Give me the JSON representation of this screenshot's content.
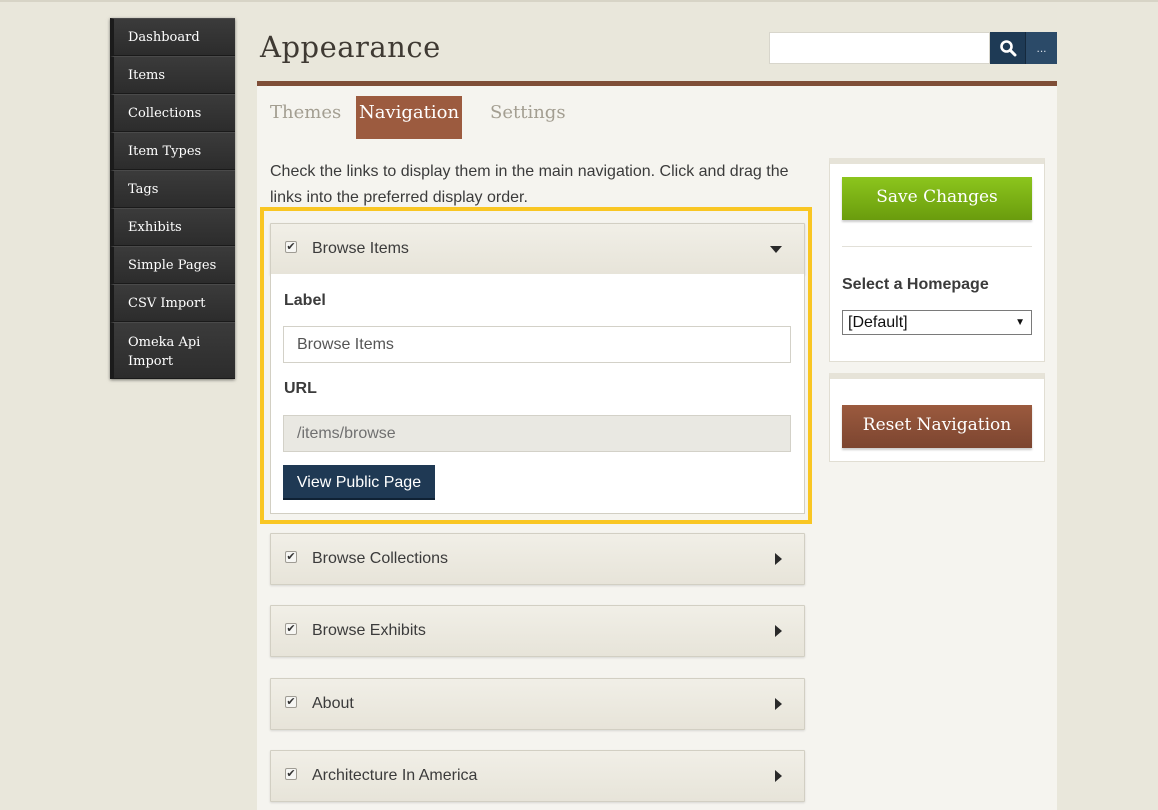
{
  "sidebar": {
    "items": [
      {
        "label": "Dashboard"
      },
      {
        "label": "Items"
      },
      {
        "label": "Collections"
      },
      {
        "label": "Item Types"
      },
      {
        "label": "Tags"
      },
      {
        "label": "Exhibits"
      },
      {
        "label": "Simple Pages"
      },
      {
        "label": "CSV Import"
      },
      {
        "label": "Omeka Api Import"
      }
    ]
  },
  "header": {
    "title": "Appearance",
    "search_value": "",
    "advanced_label": "..."
  },
  "tabs": [
    {
      "label": "Themes",
      "active": false
    },
    {
      "label": "Navigation",
      "active": true
    },
    {
      "label": "Settings",
      "active": false
    }
  ],
  "intro": "Check the links to display them in the main navigation. Click and drag the links into the preferred display order.",
  "nav_links": [
    {
      "label": "Browse Items",
      "checked": true,
      "expanded": true
    },
    {
      "label": "Browse Collections",
      "checked": true,
      "expanded": false
    },
    {
      "label": "Browse Exhibits",
      "checked": true,
      "expanded": false
    },
    {
      "label": "About",
      "checked": true,
      "expanded": false
    },
    {
      "label": "Architecture In America",
      "checked": true,
      "expanded": false
    }
  ],
  "expanded_item": {
    "label_heading": "Label",
    "label_value": "Browse Items",
    "url_heading": "URL",
    "url_value": "/items/browse",
    "view_button": "View Public Page"
  },
  "side": {
    "save_label": "Save Changes",
    "homepage_label": "Select a Homepage",
    "homepage_value": "[Default]",
    "reset_label": "Reset Navigation"
  },
  "colors": {
    "accent": "#9c5b3f",
    "highlight": "#f9c623",
    "save": "#7cb316",
    "primary": "#1f3954"
  }
}
